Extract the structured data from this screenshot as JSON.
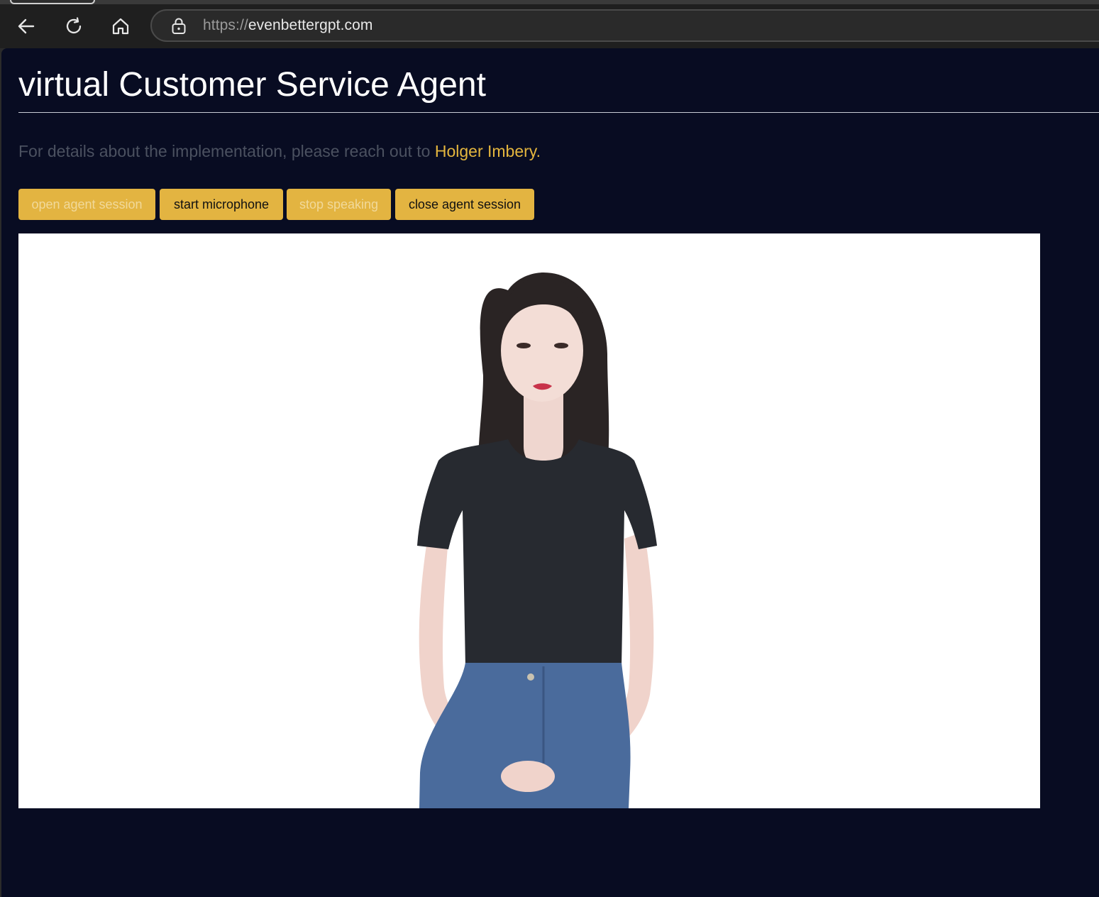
{
  "browser": {
    "url_scheme": "https://",
    "url_host": "evenbettergpt.com",
    "icons": {
      "back": "back-arrow-icon",
      "reload": "reload-icon",
      "home": "home-icon",
      "lock": "lock-icon"
    }
  },
  "page": {
    "title": "virtual Customer Service Agent",
    "info_prefix": "For details about the implementation, please reach out to",
    "info_link": "Holger Imbery.",
    "colors": {
      "background": "#080c22",
      "accent": "#e3b441",
      "muted_text": "#4b5160"
    }
  },
  "controls": {
    "open_session": {
      "label": "open agent session",
      "enabled": false
    },
    "start_microphone": {
      "label": "start microphone",
      "enabled": true
    },
    "stop_speaking": {
      "label": "stop speaking",
      "enabled": false
    },
    "close_session": {
      "label": "close agent session",
      "enabled": true
    }
  },
  "avatar": {
    "description_icon": "avatar-video"
  }
}
